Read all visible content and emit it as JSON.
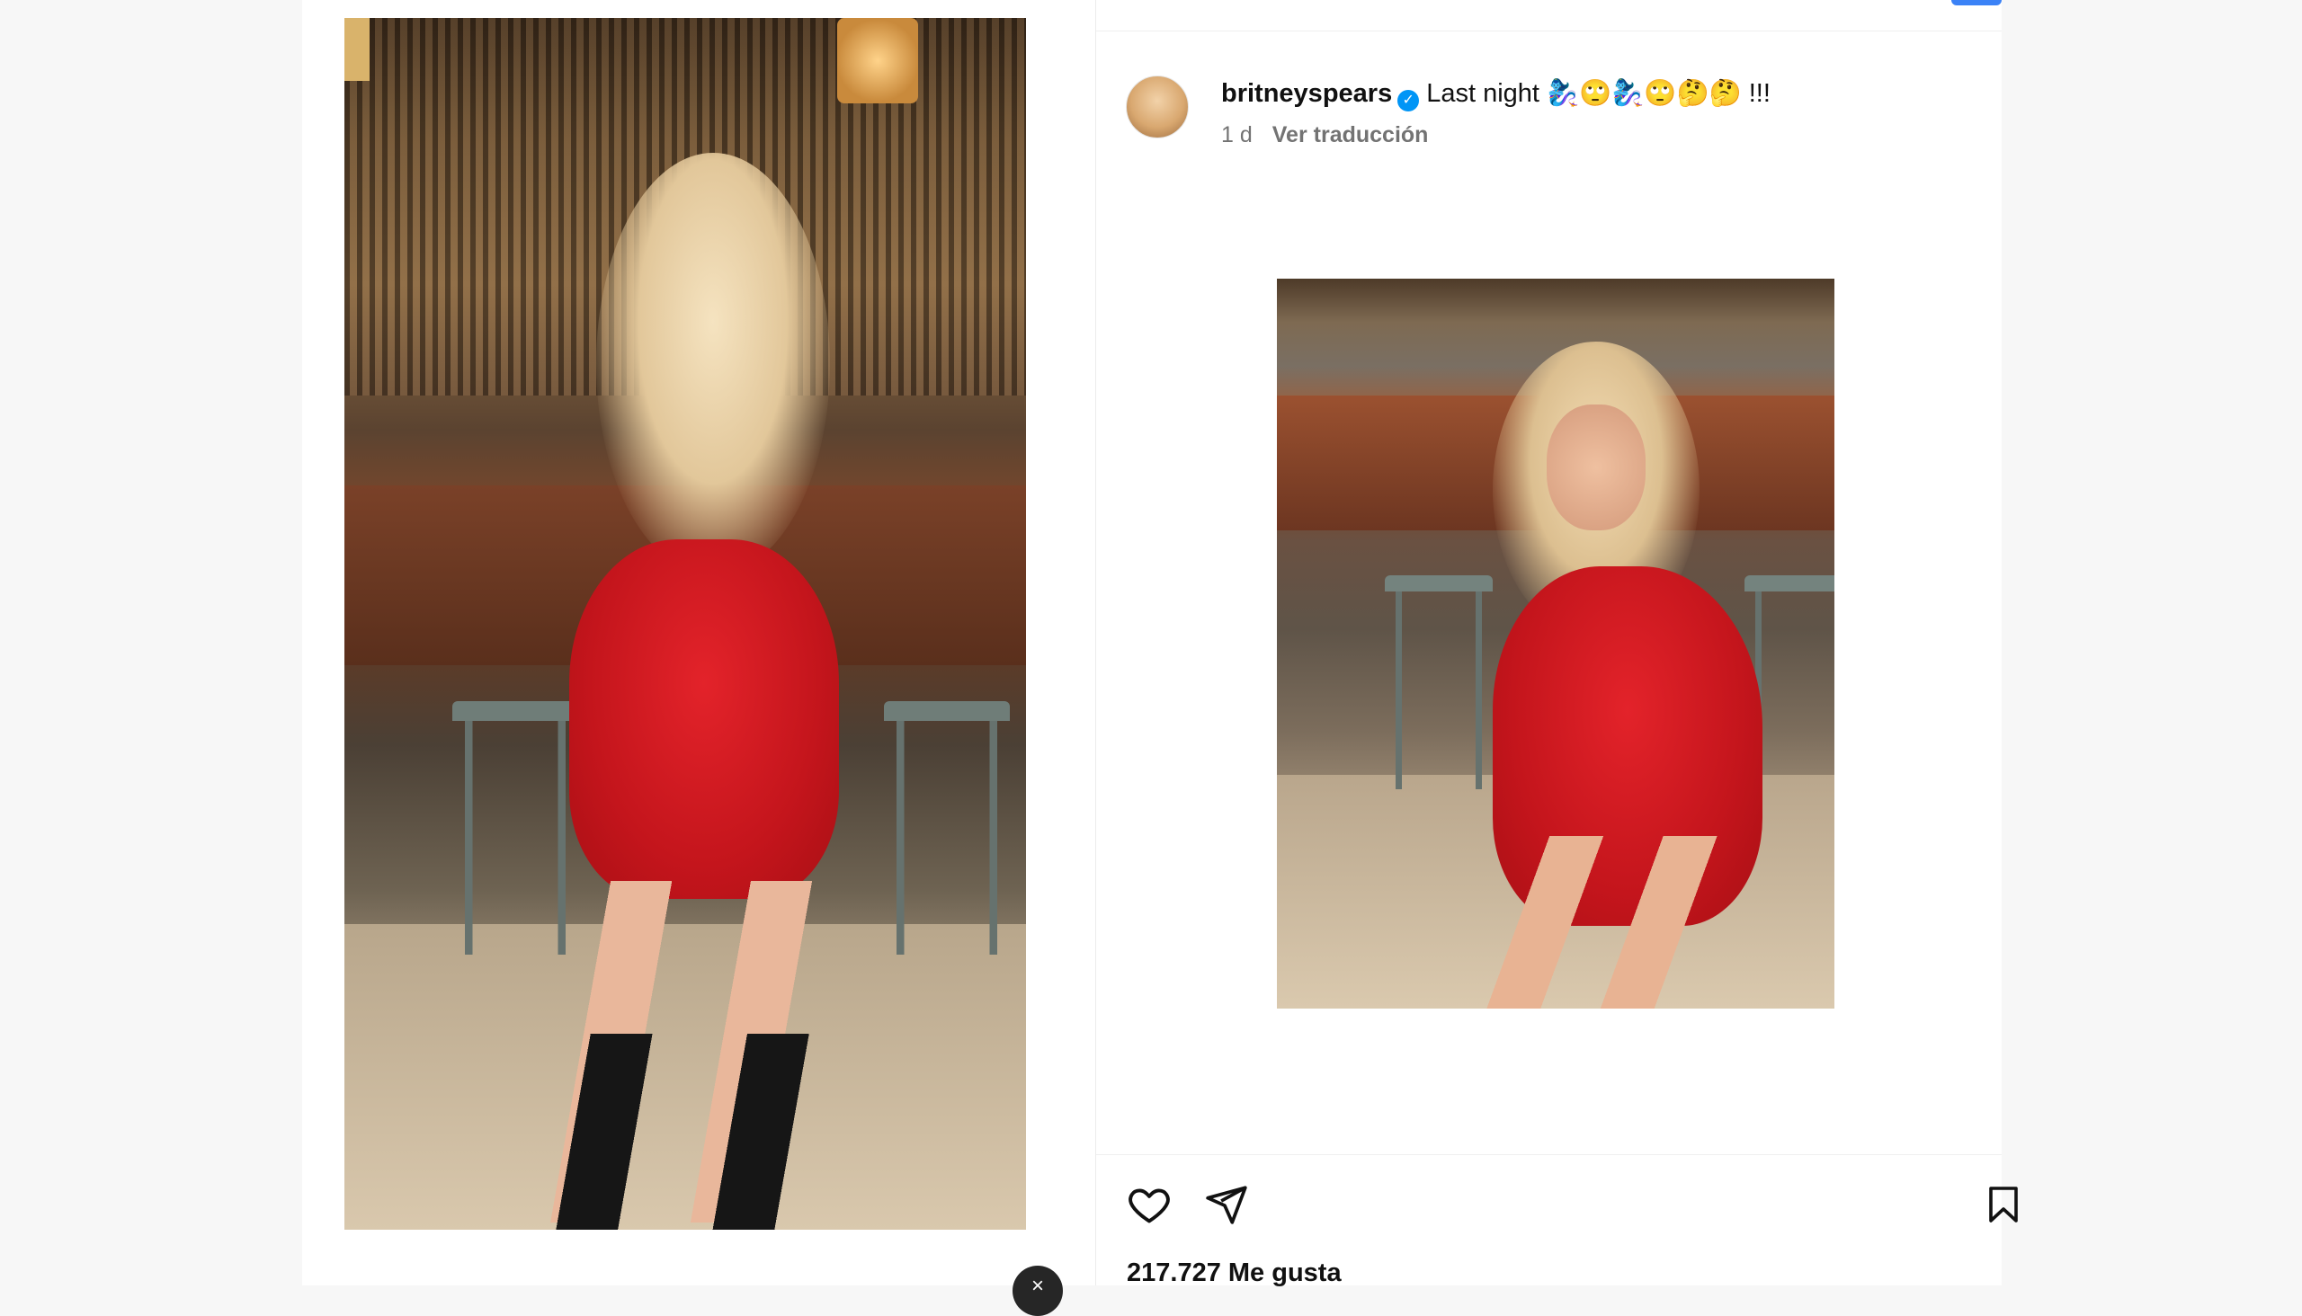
{
  "post": {
    "username": "britneyspears",
    "verified": true,
    "caption": "Last night 🧞‍♀️🙄🧞‍♀️🙄🤔🤔 !!!",
    "time_ago": "1 d",
    "translate_label": "Ver traducción",
    "likes_text": "217.727 Me gusta"
  },
  "icons": {
    "like": "heart-icon",
    "share": "paper-plane-icon",
    "save": "bookmark-icon",
    "verified": "verified-badge-icon",
    "close": "close-icon"
  },
  "colors": {
    "accent_blue": "#3b82f6",
    "verified_blue": "#0095f6",
    "text_secondary": "#737373",
    "dress_red": "#d11a20"
  }
}
